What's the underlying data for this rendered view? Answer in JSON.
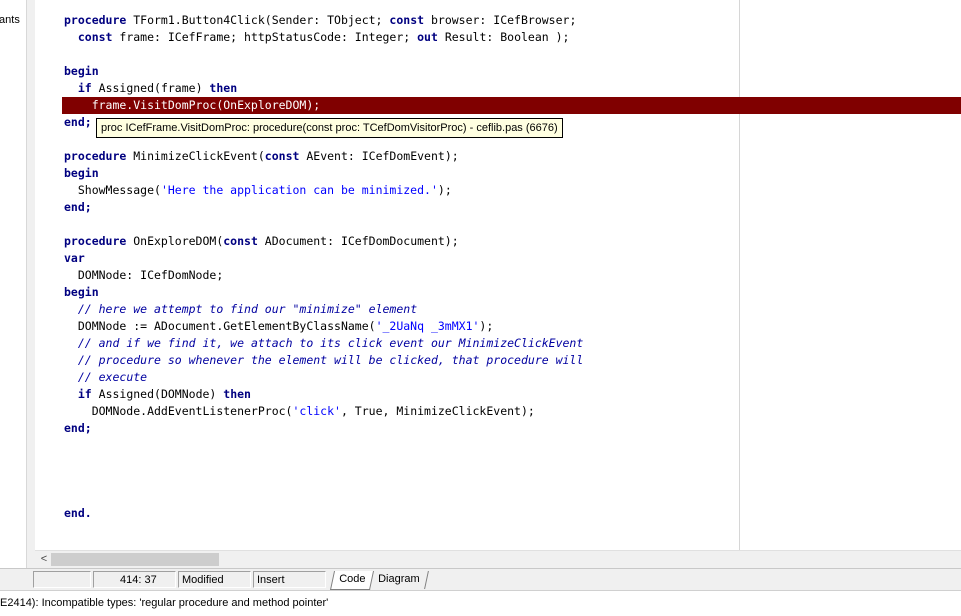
{
  "left_panel": {
    "label": "tants"
  },
  "editor": {
    "lines": [
      [
        {
          "t": "procedure",
          "c": "kw"
        },
        {
          "t": " TForm1.Button4Click(Sender: TObject; ",
          "c": "plain"
        },
        {
          "t": "const",
          "c": "kw"
        },
        {
          "t": " browser: ICefBrowser;",
          "c": "plain"
        }
      ],
      [
        {
          "t": "  ",
          "c": "plain"
        },
        {
          "t": "const",
          "c": "kw"
        },
        {
          "t": " frame: ICefFrame; httpStatusCode: Integer; ",
          "c": "plain"
        },
        {
          "t": "out",
          "c": "kw"
        },
        {
          "t": " Result: Boolean );",
          "c": "plain"
        }
      ],
      [],
      [
        {
          "t": "begin",
          "c": "kw"
        }
      ],
      [
        {
          "t": "  ",
          "c": "plain"
        },
        {
          "t": "if",
          "c": "kw"
        },
        {
          "t": " Assigned(frame) ",
          "c": "plain"
        },
        {
          "t": "then",
          "c": "kw"
        }
      ],
      [],
      [
        {
          "t": "end;",
          "c": "kw"
        }
      ],
      [],
      [
        {
          "t": "procedure",
          "c": "kw"
        },
        {
          "t": " MinimizeClickEvent(",
          "c": "plain"
        },
        {
          "t": "const",
          "c": "kw"
        },
        {
          "t": " AEvent: ICefDomEvent);",
          "c": "plain"
        }
      ],
      [
        {
          "t": "begin",
          "c": "kw"
        }
      ],
      [
        {
          "t": "  ShowMessage(",
          "c": "plain"
        },
        {
          "t": "'Here the application can be minimized.'",
          "c": "str"
        },
        {
          "t": ");",
          "c": "plain"
        }
      ],
      [
        {
          "t": "end;",
          "c": "kw"
        }
      ],
      [],
      [
        {
          "t": "procedure",
          "c": "kw"
        },
        {
          "t": " OnExploreDOM(",
          "c": "plain"
        },
        {
          "t": "const",
          "c": "kw"
        },
        {
          "t": " ADocument: ICefDomDocument);",
          "c": "plain"
        }
      ],
      [
        {
          "t": "var",
          "c": "kw"
        }
      ],
      [
        {
          "t": "  DOMNode: ICefDomNode;",
          "c": "plain"
        }
      ],
      [
        {
          "t": "begin",
          "c": "kw"
        }
      ],
      [
        {
          "t": "  ",
          "c": "plain"
        },
        {
          "t": "// here we attempt to find our \"minimize\" element",
          "c": "cm"
        }
      ],
      [
        {
          "t": "  DOMNode := ADocument.GetElementByClassName(",
          "c": "plain"
        },
        {
          "t": "'_2UaNq _3mMX1'",
          "c": "str"
        },
        {
          "t": ");",
          "c": "plain"
        }
      ],
      [
        {
          "t": "  ",
          "c": "plain"
        },
        {
          "t": "// and if we find it, we attach to its click event our MinimizeClickEvent",
          "c": "cm"
        }
      ],
      [
        {
          "t": "  ",
          "c": "plain"
        },
        {
          "t": "// procedure so whenever the element will be clicked, that procedure will",
          "c": "cm"
        }
      ],
      [
        {
          "t": "  ",
          "c": "plain"
        },
        {
          "t": "// execute",
          "c": "cm"
        }
      ],
      [
        {
          "t": "  ",
          "c": "plain"
        },
        {
          "t": "if",
          "c": "kw"
        },
        {
          "t": " Assigned(DOMNode) ",
          "c": "plain"
        },
        {
          "t": "then",
          "c": "kw"
        }
      ],
      [
        {
          "t": "    DOMNode.AddEventListenerProc(",
          "c": "plain"
        },
        {
          "t": "'click'",
          "c": "str"
        },
        {
          "t": ", True, MinimizeClickEvent);",
          "c": "plain"
        }
      ],
      [
        {
          "t": "end;",
          "c": "kw"
        }
      ],
      [],
      [],
      [],
      [],
      [
        {
          "t": "end.",
          "c": "kw"
        }
      ]
    ],
    "highlighted_line": "    frame.VisitDomProc(OnExploreDOM);",
    "tooltip": "proc  ICefFrame.VisitDomProc: procedure(const proc: TCefDomVisitorProc) - ceflib.pas (6676)"
  },
  "scrollbar": {
    "left_arrow": "<"
  },
  "statusbar": {
    "position": "414:  37",
    "modified": "Modified",
    "insert": "Insert",
    "tabs": [
      "Code",
      "Diagram"
    ]
  },
  "message": "E2414): Incompatible types: 'regular procedure and method pointer'"
}
